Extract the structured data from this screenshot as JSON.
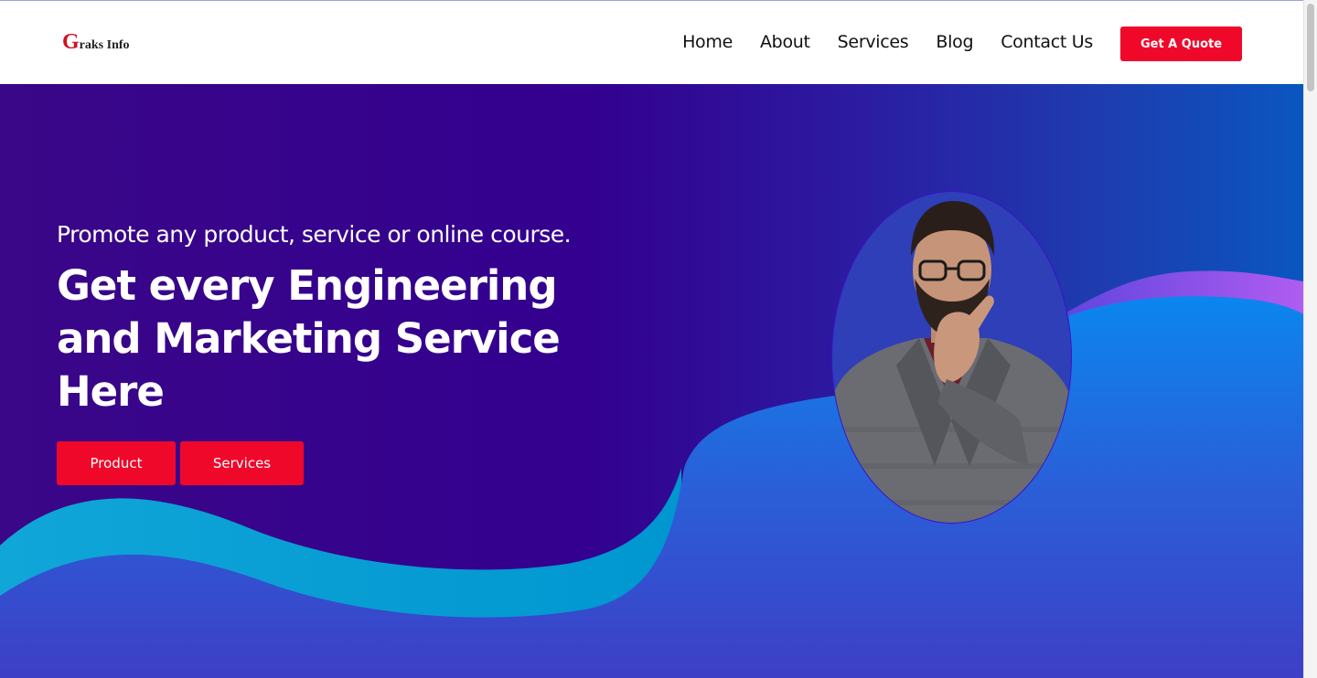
{
  "header": {
    "logo": {
      "initial": "G",
      "rest": "raks Info"
    },
    "nav": [
      "Home",
      "About",
      "Services",
      "Blog",
      "Contact Us"
    ],
    "cta_label": "Get A Quote"
  },
  "hero": {
    "subtitle": "Promote any product, service or online course.",
    "headline": "Get every Engineering and Marketing Service Here",
    "buttons": {
      "product": "Product",
      "services": "Services"
    }
  },
  "colors": {
    "brand_red": "#f0082a",
    "hero_purple": "#33008f",
    "hero_blue": "#0a56c0",
    "wave_cyan": "#00a8d8",
    "wave_violet": "#a855f7"
  },
  "icons": {
    "portrait": "man-with-glasses-photo"
  }
}
